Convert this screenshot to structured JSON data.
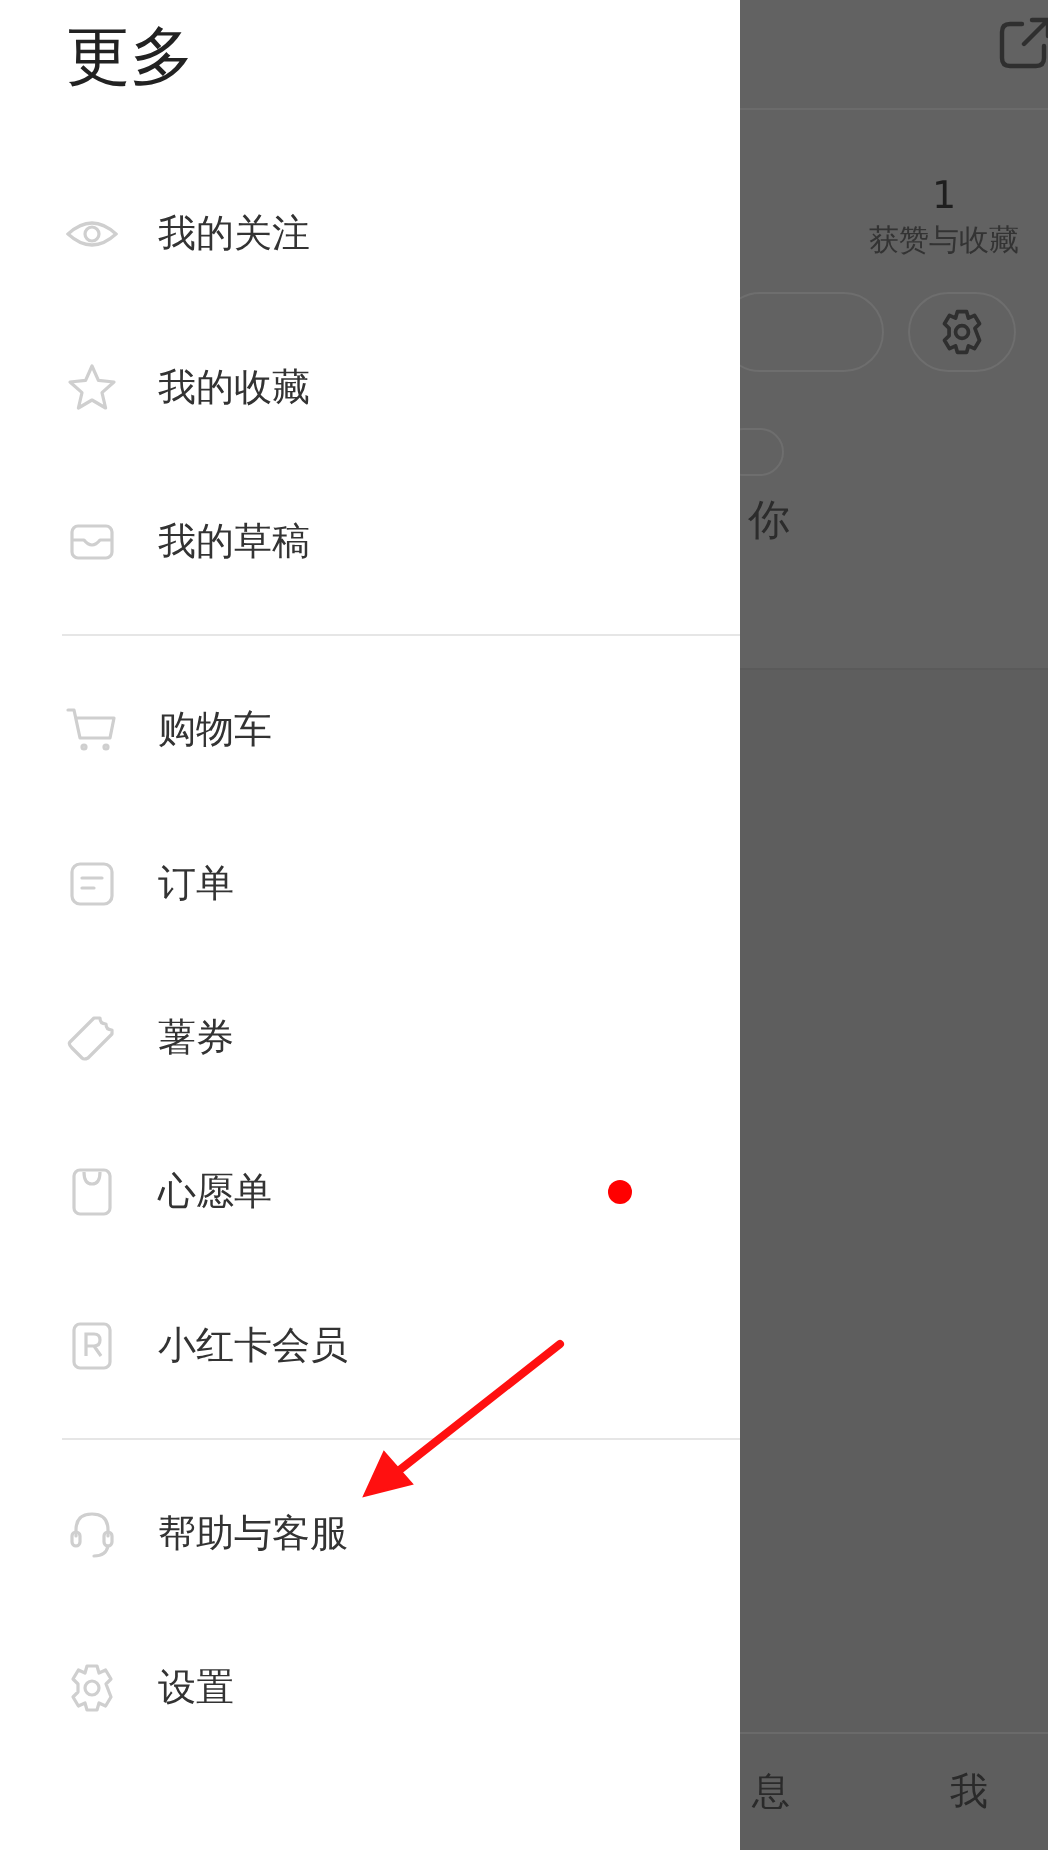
{
  "drawer": {
    "title": "更多",
    "groups": [
      [
        {
          "label": "我的关注",
          "kind": "eye",
          "badge": false
        },
        {
          "label": "我的收藏",
          "kind": "star",
          "badge": false
        },
        {
          "label": "我的草稿",
          "kind": "tray",
          "badge": false
        }
      ],
      [
        {
          "label": "购物车",
          "kind": "cart",
          "badge": false
        },
        {
          "label": "订单",
          "kind": "order",
          "badge": false
        },
        {
          "label": "薯券",
          "kind": "ticket",
          "badge": false
        },
        {
          "label": "心愿单",
          "kind": "bag",
          "badge": true
        },
        {
          "label": "小红卡会员",
          "kind": "card",
          "badge": false
        }
      ],
      [
        {
          "label": "帮助与客服",
          "kind": "headset",
          "badge": false
        },
        {
          "label": "设置",
          "kind": "gear",
          "badge": false
        }
      ]
    ]
  },
  "background": {
    "stat_value": "1",
    "stat_label": "获赞与收藏",
    "text": "你",
    "tabs": [
      "息",
      "我"
    ]
  }
}
